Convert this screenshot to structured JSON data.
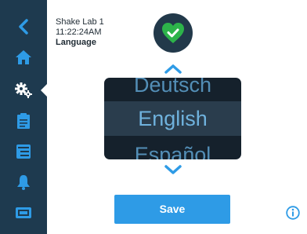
{
  "device": {
    "name": "Shake Lab 1",
    "time": "11:22:24AM",
    "screen_label": "Language"
  },
  "sidebar": {
    "items": [
      {
        "name": "back",
        "icon": "chevron-left-icon"
      },
      {
        "name": "home",
        "icon": "home-icon"
      },
      {
        "name": "settings",
        "icon": "gears-icon",
        "active": true
      },
      {
        "name": "protocols",
        "icon": "clipboard-icon"
      },
      {
        "name": "log",
        "icon": "log-icon"
      },
      {
        "name": "alarms",
        "icon": "bell-icon"
      },
      {
        "name": "display",
        "icon": "display-icon"
      }
    ]
  },
  "status": {
    "icon": "heart-check-icon",
    "color": "#2db34a"
  },
  "language_picker": {
    "previous": "Deutsch",
    "selected": "English",
    "next": "Español"
  },
  "actions": {
    "save_label": "Save"
  },
  "colors": {
    "sidebar_bg": "#1e3a4f",
    "accent": "#2e9be6",
    "picker_text": "#5ea2cf",
    "status_green": "#2db34a"
  }
}
